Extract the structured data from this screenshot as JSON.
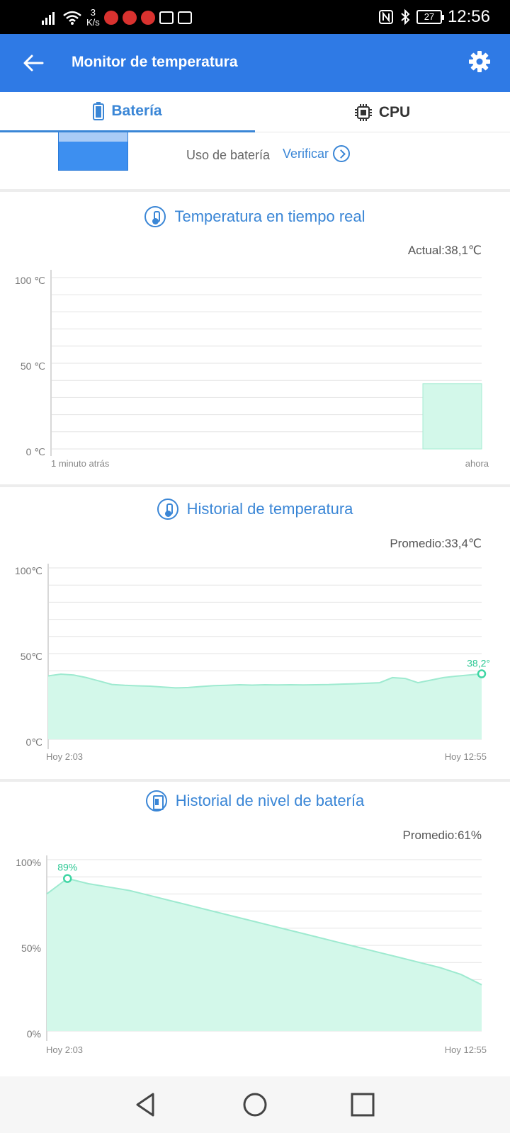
{
  "status_bar": {
    "speed_value": "3",
    "speed_unit": "K/s",
    "battery": "27",
    "time": "12:56"
  },
  "app_bar": {
    "title": "Monitor de temperatura"
  },
  "tabs": [
    {
      "label": "Batería",
      "active": true
    },
    {
      "label": "CPU",
      "active": false
    }
  ],
  "usage": {
    "label": "Uso de batería",
    "action": "Verificar"
  },
  "realtime": {
    "title": "Temperatura en tiempo real",
    "stat": "Actual:38,1℃",
    "y_ticks": [
      "100 ℃",
      "50 ℃",
      "0 ℃"
    ],
    "x_start": "1 minuto atrás",
    "x_end": "ahora"
  },
  "temp_history": {
    "title": "Historial de temperatura",
    "stat": "Promedio:33,4℃",
    "y_ticks": [
      "100℃",
      "50℃",
      "0℃"
    ],
    "x_start": "Hoy 2:03",
    "x_end": "Hoy 12:55",
    "last_label": "38,2°"
  },
  "battery_history": {
    "title": "Historial de nivel de batería",
    "stat": "Promedio:61%",
    "y_ticks": [
      "100%",
      "50%",
      "0%"
    ],
    "x_start": "Hoy 2:03",
    "x_end": "Hoy 12:55",
    "peak_label": "89%"
  },
  "chart_data": [
    {
      "type": "bar",
      "title": "Temperatura en tiempo real",
      "ylim": [
        0,
        100
      ],
      "unit": "℃",
      "x_range": [
        "1 minuto atrás",
        "ahora"
      ],
      "values": [
        38.1
      ]
    },
    {
      "type": "area",
      "title": "Historial de temperatura",
      "ylim": [
        0,
        100
      ],
      "unit": "℃",
      "x_range": [
        "Hoy 2:03",
        "Hoy 12:55"
      ],
      "values": [
        37,
        38,
        37.5,
        36,
        34,
        32,
        31.5,
        31.2,
        31,
        30.5,
        30,
        30.2,
        30.8,
        31.3,
        31.5,
        31.8,
        31.6,
        31.8,
        31.7,
        31.8,
        31.7,
        31.8,
        31.9,
        32.2,
        32.4,
        32.7,
        33,
        36,
        35.5,
        33,
        34.5,
        36,
        36.8,
        37.5,
        38.2
      ],
      "last_value": 38.2
    },
    {
      "type": "area",
      "title": "Historial de nivel de batería",
      "ylim": [
        0,
        100
      ],
      "unit": "%",
      "x_range": [
        "Hoy 2:03",
        "Hoy 12:55"
      ],
      "values": [
        80,
        89,
        86,
        84,
        82,
        79,
        76,
        73,
        70,
        67,
        64,
        61,
        58,
        55,
        52,
        49,
        46,
        43,
        40,
        37,
        33,
        27
      ],
      "peak_value": 89
    }
  ]
}
